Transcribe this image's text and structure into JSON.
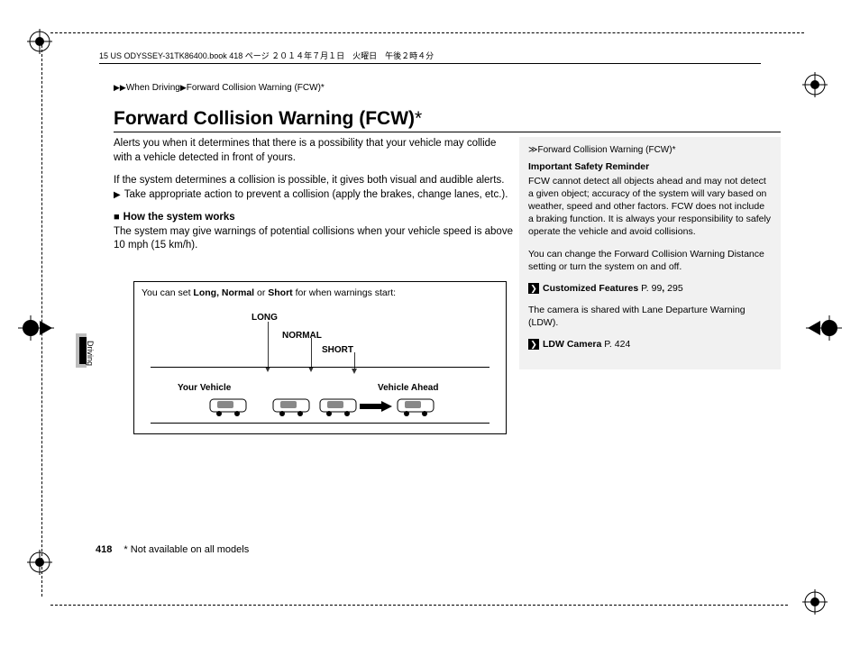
{
  "header_line": "15 US ODYSSEY-31TK86400.book  418 ページ  ２０１４年７月１日　火曜日　午後２時４分",
  "breadcrumb": {
    "a": "When Driving",
    "b": "Forward Collision Warning (FCW)",
    "star": "*"
  },
  "title": "Forward Collision Warning (FCW)",
  "title_star": "*",
  "left": {
    "p1": "Alerts you when it determines that there is a possibility that your vehicle may collide with a vehicle detected in front of yours.",
    "p2": "If the system determines a collision is possible, it gives both visual and audible alerts.",
    "p2b": "Take appropriate action to prevent a collision (apply the brakes, change lanes, etc.).",
    "h3": "How the system works",
    "p3": "The system may give warnings of potential collisions when your vehicle speed is above 10 mph (15 km/h)."
  },
  "diagram": {
    "caption_pre": "You can set ",
    "caption_b": "Long, Normal",
    "caption_mid": " or ",
    "caption_b2": "Short",
    "caption_post": " for when warnings start:",
    "long": "LONG",
    "normal": "NORMAL",
    "short": "SHORT",
    "your": "Your Vehicle",
    "ahead": "Vehicle Ahead"
  },
  "side": {
    "title": "Forward Collision Warning (FCW)",
    "title_star": "*",
    "h": "Important Safety Reminder",
    "p1": "FCW cannot detect all objects ahead and may not detect a given object; accuracy of the system will vary based on weather, speed and other factors. FCW does not include a braking function. It is always your responsibility to safely operate the vehicle and avoid collisions.",
    "p2": "You can change the Forward Collision Warning Distance setting or turn the system on and off.",
    "x1": "Customized Features",
    "x1p": " P. 99",
    "x1c": ", ",
    "x1p2": "295",
    "p3": "The camera is shared with Lane Departure Warning (LDW).",
    "x2": "LDW Camera",
    "x2p": " P. 424"
  },
  "side_label": "Driving",
  "foot": {
    "page": "418",
    "note": "* Not available on all models"
  }
}
